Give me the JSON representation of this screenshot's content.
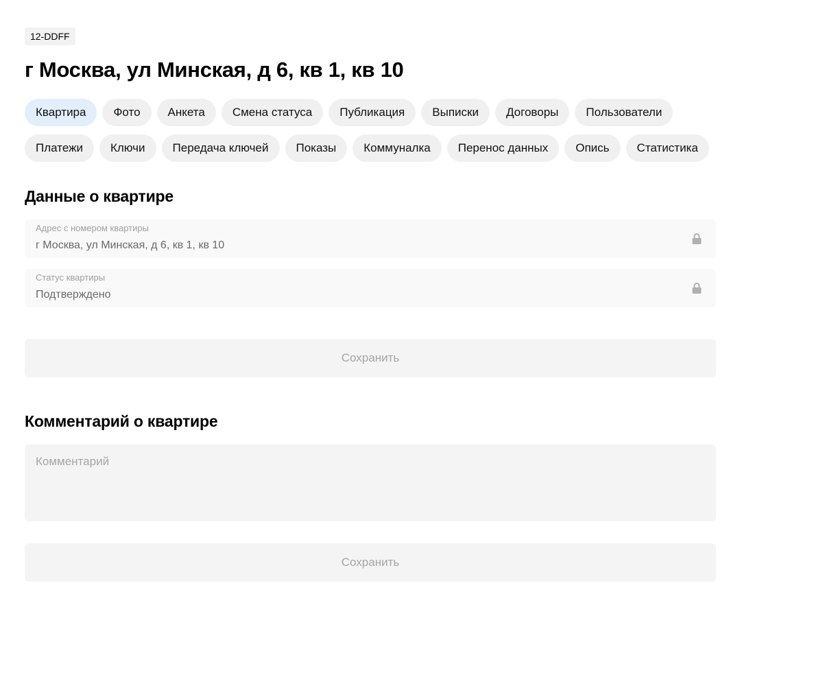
{
  "flat_id": "12-DDFF",
  "title": "г Москва, ул Минская, д 6, кв 1, кв 10",
  "tabs_row1": [
    {
      "label": "Квартира",
      "active": true
    },
    {
      "label": "Фото"
    },
    {
      "label": "Анкета"
    },
    {
      "label": "Смена статуса"
    },
    {
      "label": "Публикация"
    },
    {
      "label": "Выписки"
    },
    {
      "label": "Договоры"
    },
    {
      "label": "Пользователи"
    }
  ],
  "tabs_row2": [
    {
      "label": "Платежи"
    },
    {
      "label": "Ключи"
    },
    {
      "label": "Передача ключей"
    },
    {
      "label": "Показы"
    },
    {
      "label": "Коммуналка"
    },
    {
      "label": "Перенос данных"
    },
    {
      "label": "Опись"
    },
    {
      "label": "Статистика"
    }
  ],
  "flat_data": {
    "section_title": "Данные о квартире",
    "address_field": {
      "label": "Адрес с номером квартиры",
      "value": "г Москва, ул Минская, д 6, кв 1, кв 10",
      "icon": "lock-icon"
    },
    "status_field": {
      "label": "Статус квартиры",
      "value": "Подтверждено",
      "icon": "lock-icon"
    },
    "save_label": "Сохранить"
  },
  "comment": {
    "section_title": "Комментарий о квартире",
    "placeholder": "Комментарий",
    "value": "",
    "save_label": "Сохранить"
  },
  "colors": {
    "active_tab": "#e2eefb",
    "tab": "#f0f0f0",
    "field_bg": "#f9f9f9",
    "button_disabled_bg": "#f4f4f4",
    "button_disabled_text": "#a5a5a5"
  }
}
